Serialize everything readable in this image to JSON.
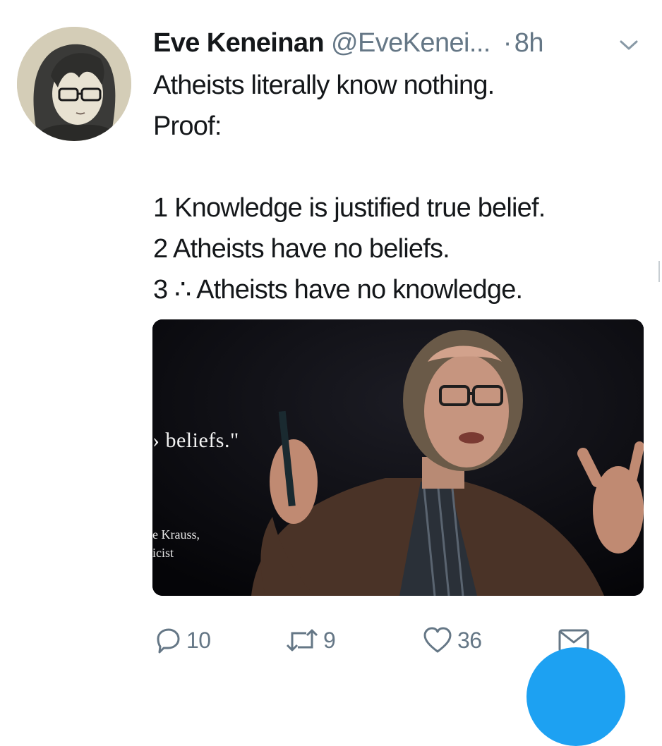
{
  "tweet": {
    "author_name": "Eve Keneinan",
    "handle": "@EveKenei...",
    "separator": "·",
    "time": "8h",
    "text": "Atheists literally know nothing.\nProof:\n\n1 Knowledge is justified true belief.\n2 Atheists have no beliefs.\n3 ∴ Atheists have no knowledge."
  },
  "media": {
    "overlay_quote": "› beliefs.\"",
    "overlay_caption_line1": "e Krauss,",
    "overlay_caption_line2": "icist"
  },
  "actions": {
    "reply_count": "10",
    "retweet_count": "9",
    "like_count": "36"
  },
  "icons": {
    "reply": "reply-icon",
    "retweet": "retweet-icon",
    "like": "heart-icon",
    "dm": "envelope-icon",
    "menu": "chevron-down-icon"
  },
  "colors": {
    "secondary_text": "#657786",
    "accent": "#1da1f2"
  }
}
